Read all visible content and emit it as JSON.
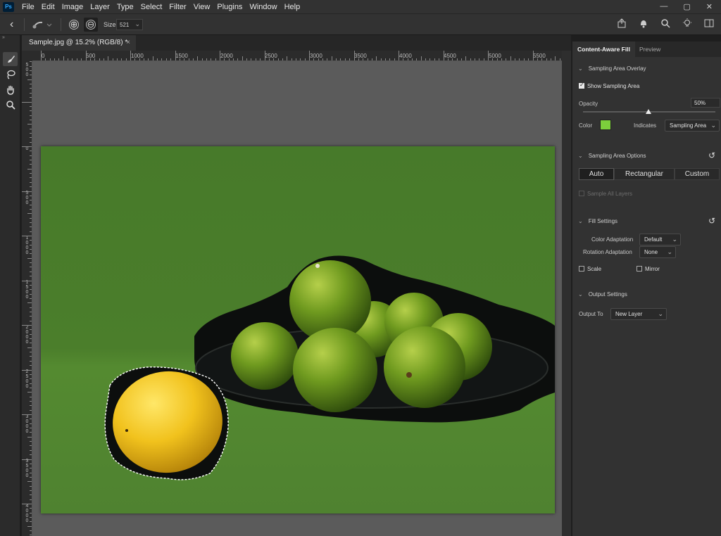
{
  "app": {
    "logo_text": "Ps",
    "menu": [
      "File",
      "Edit",
      "Image",
      "Layer",
      "Type",
      "Select",
      "Filter",
      "View",
      "Plugins",
      "Window",
      "Help"
    ],
    "window_controls": [
      "—",
      "▢",
      "✕"
    ]
  },
  "options_bar": {
    "back_icon": "‹",
    "add_icon": "⊕",
    "subtract_icon": "⊖",
    "size_label": "Size",
    "size_value": "521",
    "dropdown_icon": "⌄"
  },
  "document": {
    "tab_title": "Sample.jpg @ 15.2% (RGB/8) *",
    "close_icon": "×"
  },
  "rulers": {
    "top_labels": [
      "0",
      "500",
      "1000",
      "1500",
      "2000",
      "2500",
      "3000",
      "3500",
      "4000",
      "4500",
      "5000",
      "5500"
    ],
    "left_labels": [
      "5 0 0",
      "0",
      "5 0 0",
      "1 0 0 0",
      "1 5 0 0",
      "2 0 0 0",
      "2 5 0 0",
      "3 0 0 0",
      "3 5 0 0",
      "4 0 0 0"
    ]
  },
  "panel": {
    "tabs": [
      "Content-Aware Fill",
      "Preview"
    ],
    "sampling_overlay": {
      "title": "Sampling Area Overlay",
      "show_label": "Show Sampling Area",
      "show_checked": true,
      "opacity_label": "Opacity",
      "opacity_value": "50%",
      "color_label": "Color",
      "color_swatch": "#7ccf3c",
      "indicates_label": "Indicates",
      "indicates_value": "Sampling Area"
    },
    "sampling_options": {
      "title": "Sampling Area Options",
      "buttons": [
        "Auto",
        "Rectangular",
        "Custom"
      ],
      "active": "Auto",
      "sample_all_layers": "Sample All Layers"
    },
    "fill_settings": {
      "title": "Fill Settings",
      "color_adaptation_label": "Color Adaptation",
      "color_adaptation_value": "Default",
      "rotation_adaptation_label": "Rotation Adaptation",
      "rotation_adaptation_value": "None",
      "scale_label": "Scale",
      "mirror_label": "Mirror"
    },
    "output_settings": {
      "title": "Output Settings",
      "output_to_label": "Output To",
      "output_to_value": "New Layer"
    }
  },
  "colors": {
    "background_green": "#4a7a2a",
    "overlay_dark": "#0c0e0d",
    "lemon": "#f0c21c",
    "lime": "#6e9a1e"
  }
}
